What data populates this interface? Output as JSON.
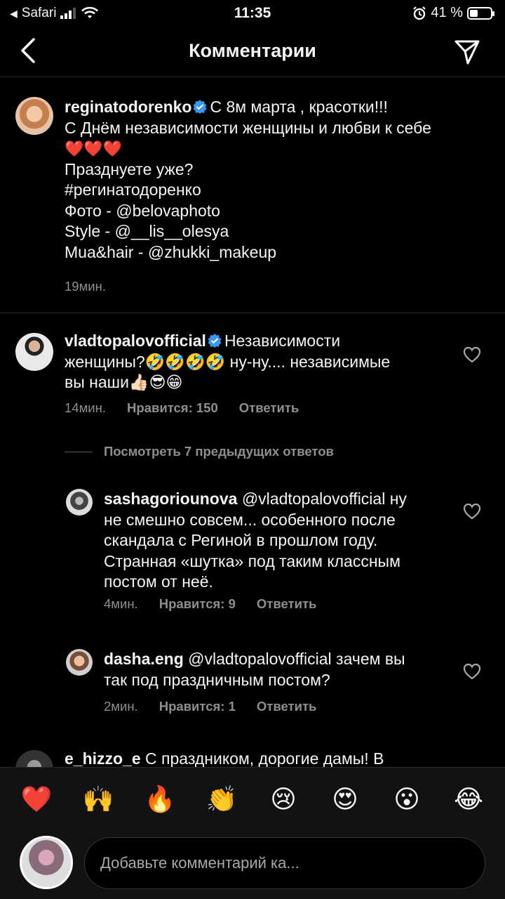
{
  "status": {
    "carrier": "Safari",
    "time": "11:35",
    "battery_percent": "41 %",
    "battery_level": 0.41
  },
  "header": {
    "title": "Комментарии"
  },
  "caption": {
    "username": "reginatodorenko",
    "lines": [
      "С 8м марта , красотки!!!",
      "С Днём независимости женщины и любви к себе",
      "❤️❤️❤️",
      "Празднуете уже?",
      "#регинатодоренко",
      "Фото - @belovaphoto",
      "Style - @__lis__olesya",
      "Mua&hair - @zhukki_makeup"
    ],
    "time": "19мин."
  },
  "comment1": {
    "username": "vladtopalovofficial",
    "lines": [
      "Независимости",
      "женщины?🤣🤣🤣🤣 ну-ну.... независимые",
      "вы наши👍🏻😎😁"
    ],
    "time": "14мин.",
    "likes": "Нравится: 150",
    "reply": "Ответить"
  },
  "view_replies": "Посмотреть 7 предыдущих ответов",
  "reply1": {
    "username": "sashagoriounova",
    "lines": [
      "@vladtopalovofficial ну",
      "не смешно совсем... особенного после",
      "скандала с Региной в прошлом году.",
      "Странная «шутка» под таким классным",
      "постом от неё."
    ],
    "time": "4мин.",
    "likes": "Нравится: 9",
    "reply": "Ответить"
  },
  "reply2": {
    "username": "dasha.eng",
    "lines": [
      "@vladtopalovofficial зачем вы",
      "так под праздничным постом?"
    ],
    "time": "2мин.",
    "likes": "Нравится: 1",
    "reply": "Ответить"
  },
  "comment2": {
    "username": "e_hizzo_e",
    "text": "С праздником, дорогие дамы! В"
  },
  "reactions": [
    "❤️",
    "🙌",
    "🔥",
    "👏",
    "😢",
    "😍",
    "😮",
    "😂"
  ],
  "input": {
    "placeholder": "Добавьте комментарий ка..."
  },
  "colors": {
    "background": "#000000",
    "secondary_text": "#8e8e8e",
    "verified": "#3897f0"
  }
}
